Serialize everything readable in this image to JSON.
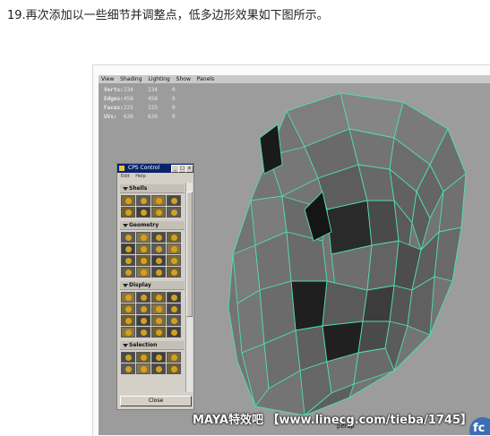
{
  "caption": "19.再次添加以一些细节并调整点，低多边形效果如下图所示。",
  "viewport": {
    "menus": [
      "View",
      "Shading",
      "Lighting",
      "Show",
      "Panels"
    ],
    "hud": [
      {
        "label": "Verts:",
        "v1": "234",
        "v2": "234",
        "v3": "0"
      },
      {
        "label": "Edges:",
        "v1": "458",
        "v2": "458",
        "v3": "0"
      },
      {
        "label": "Faces:",
        "v1": "225",
        "v2": "225",
        "v3": "0"
      },
      {
        "label": "UVs:",
        "v1": "626",
        "v2": "626",
        "v3": "0"
      }
    ],
    "camera_label": "persp",
    "mesh_color": "#6f6f6f",
    "wire_color": "#4fe0a8"
  },
  "cps_panel": {
    "title": "CPS Control",
    "menu": [
      "Edit",
      "Help"
    ],
    "sections": [
      {
        "label": "Shells",
        "icon_count": 8
      },
      {
        "label": "Geometry",
        "icon_count": 16
      },
      {
        "label": "Display",
        "icon_count": 16
      },
      {
        "label": "Selection",
        "icon_count": 8
      }
    ],
    "close_label": "Close"
  },
  "watermark": "MAYA特效吧 【www.linecg.com/tieba/1745】",
  "badge_text": "fc"
}
